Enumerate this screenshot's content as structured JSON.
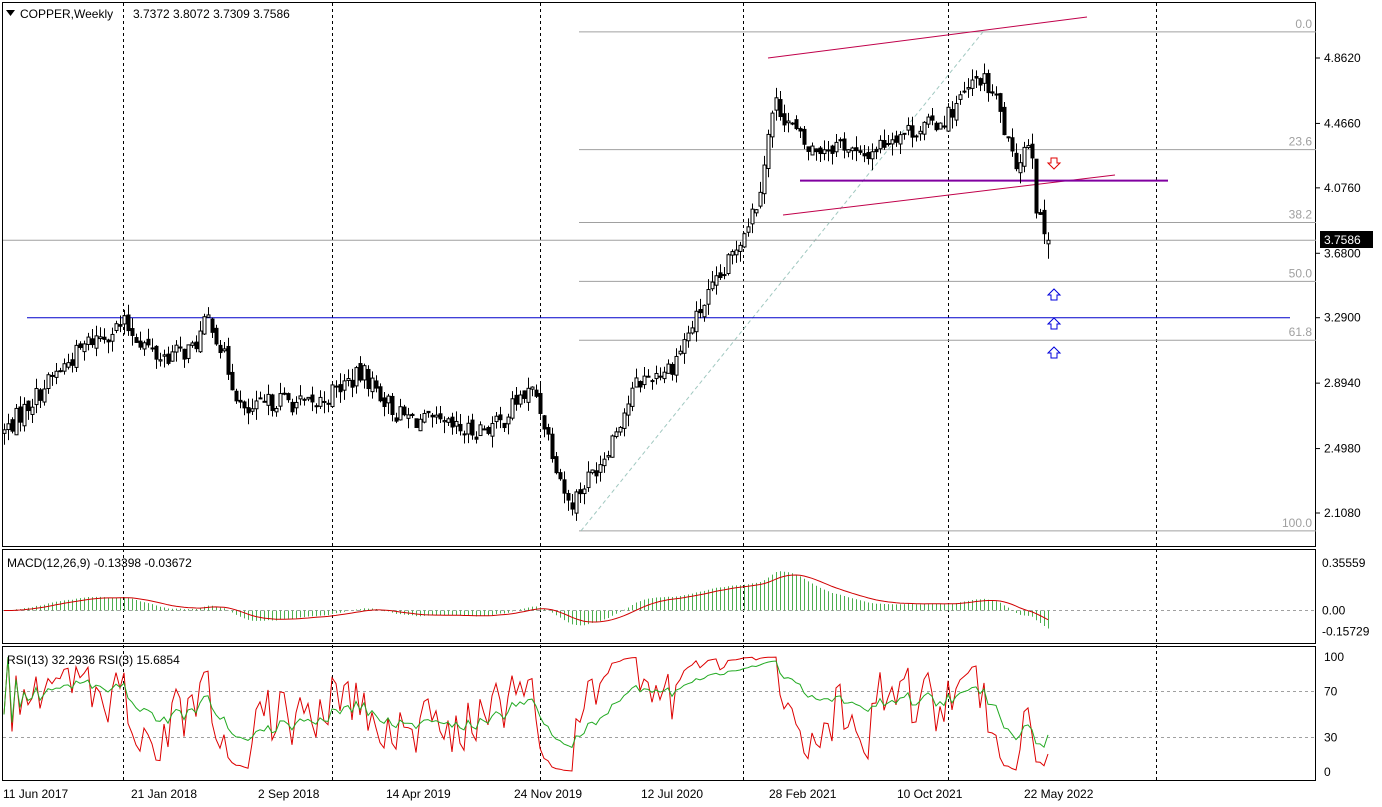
{
  "header": {
    "symbol": "COPPER,Weekly",
    "ohlc": "3.7372 3.8072 3.7309 3.7586"
  },
  "price_axis": {
    "ticks": [
      "4.8620",
      "4.4660",
      "4.0760",
      "3.6800",
      "3.2900",
      "2.8940",
      "2.4980",
      "2.1080"
    ],
    "current_price": "3.7586",
    "current_price_bg": "#000000"
  },
  "fibonacci": {
    "levels": [
      "0.0",
      "23.6",
      "38.2",
      "50.0",
      "61.8",
      "100.0"
    ],
    "color": "#a0a0a0"
  },
  "macd": {
    "label": "MACD(12,26,9) -0.13398 -0.03672",
    "ticks": [
      "0.35559",
      "0.00",
      "-0.15729"
    ],
    "histogram_color": "#4caf50",
    "signal_color": "#d00000"
  },
  "rsi": {
    "label": "RSI(13) 32.2936  RSI(3) 15.6854",
    "ticks": [
      "100",
      "70",
      "30",
      "0"
    ],
    "rsi13_color": "#22aa22",
    "rsi3_color": "#dd0000"
  },
  "x_axis": {
    "labels": [
      "11 Jun 2017",
      "21 Jan 2018",
      "2 Sep 2018",
      "14 Apr 2019",
      "24 Nov 2019",
      "12 Jul 2020",
      "28 Feb 2021",
      "10 Oct 2021",
      "22 May 2022"
    ]
  },
  "colors": {
    "support_line": "#0000cc",
    "channel": "#c0004a",
    "neckline": "#8000a0",
    "arrow_down": "#e00000",
    "arrow_up": "#0000dd"
  },
  "chart_data": {
    "type": "candlestick",
    "title": "COPPER, Weekly",
    "x_labels": [
      "11 Jun 2017",
      "21 Jan 2018",
      "2 Sep 2018",
      "14 Apr 2019",
      "24 Nov 2019",
      "12 Jul 2020",
      "28 Feb 2021",
      "10 Oct 2021",
      "22 May 2022"
    ],
    "close_path": [
      [
        "Jun 2017",
        2.6
      ],
      [
        "Sep 2017",
        2.95
      ],
      [
        "Nov 2017",
        3.15
      ],
      [
        "Jan 2018",
        3.25
      ],
      [
        "Mar 2018",
        3.05
      ],
      [
        "May 2018",
        3.1
      ],
      [
        "Jun 2018",
        3.3
      ],
      [
        "Aug 2018",
        2.7
      ],
      [
        "Oct 2018",
        2.8
      ],
      [
        "Dec 2018",
        2.75
      ],
      [
        "Feb 2019",
        2.9
      ],
      [
        "Mar 2019",
        2.95
      ],
      [
        "May 2019",
        2.7
      ],
      [
        "Jul 2019",
        2.65
      ],
      [
        "Sep 2019",
        2.6
      ],
      [
        "Nov 2019",
        2.65
      ],
      [
        "Dec 2019",
        2.8
      ],
      [
        "Jan 2020",
        2.85
      ],
      [
        "Mar 2020",
        2.15
      ],
      [
        "May 2020",
        2.45
      ],
      [
        "Jul 2020",
        2.9
      ],
      [
        "Sep 2020",
        3.0
      ],
      [
        "Nov 2020",
        3.4
      ],
      [
        "Dec 2020",
        3.55
      ],
      [
        "Feb 2021",
        4.0
      ],
      [
        "Mar 2021",
        4.6
      ],
      [
        "May 2021",
        4.3
      ],
      [
        "Jul 2021",
        4.35
      ],
      [
        "Aug 2021",
        4.25
      ],
      [
        "Oct 2021",
        4.4
      ],
      [
        "Dec 2021",
        4.45
      ],
      [
        "Jan 2022",
        4.5
      ],
      [
        "Mar 2022",
        4.75
      ],
      [
        "Apr 2022",
        4.6
      ],
      [
        "May 2022",
        4.2
      ],
      [
        "Jun 2022",
        4.4
      ],
      [
        "Jun 2022",
        3.9
      ],
      [
        "Jul 2022",
        3.7586
      ]
    ],
    "last_ohlc": {
      "open": 3.7372,
      "high": 3.8072,
      "low": 3.7309,
      "close": 3.7586
    },
    "horizontal_support": 3.29,
    "neckline": 4.12,
    "ylim": [
      1.96,
      5.0
    ],
    "macd": {
      "macd": -0.13398,
      "signal": -0.03672,
      "ylim": [
        -0.22,
        0.4
      ]
    },
    "rsi": {
      "rsi13": 32.2936,
      "rsi3": 15.6854,
      "levels": [
        30,
        70
      ],
      "ylim": [
        0,
        100
      ]
    }
  }
}
